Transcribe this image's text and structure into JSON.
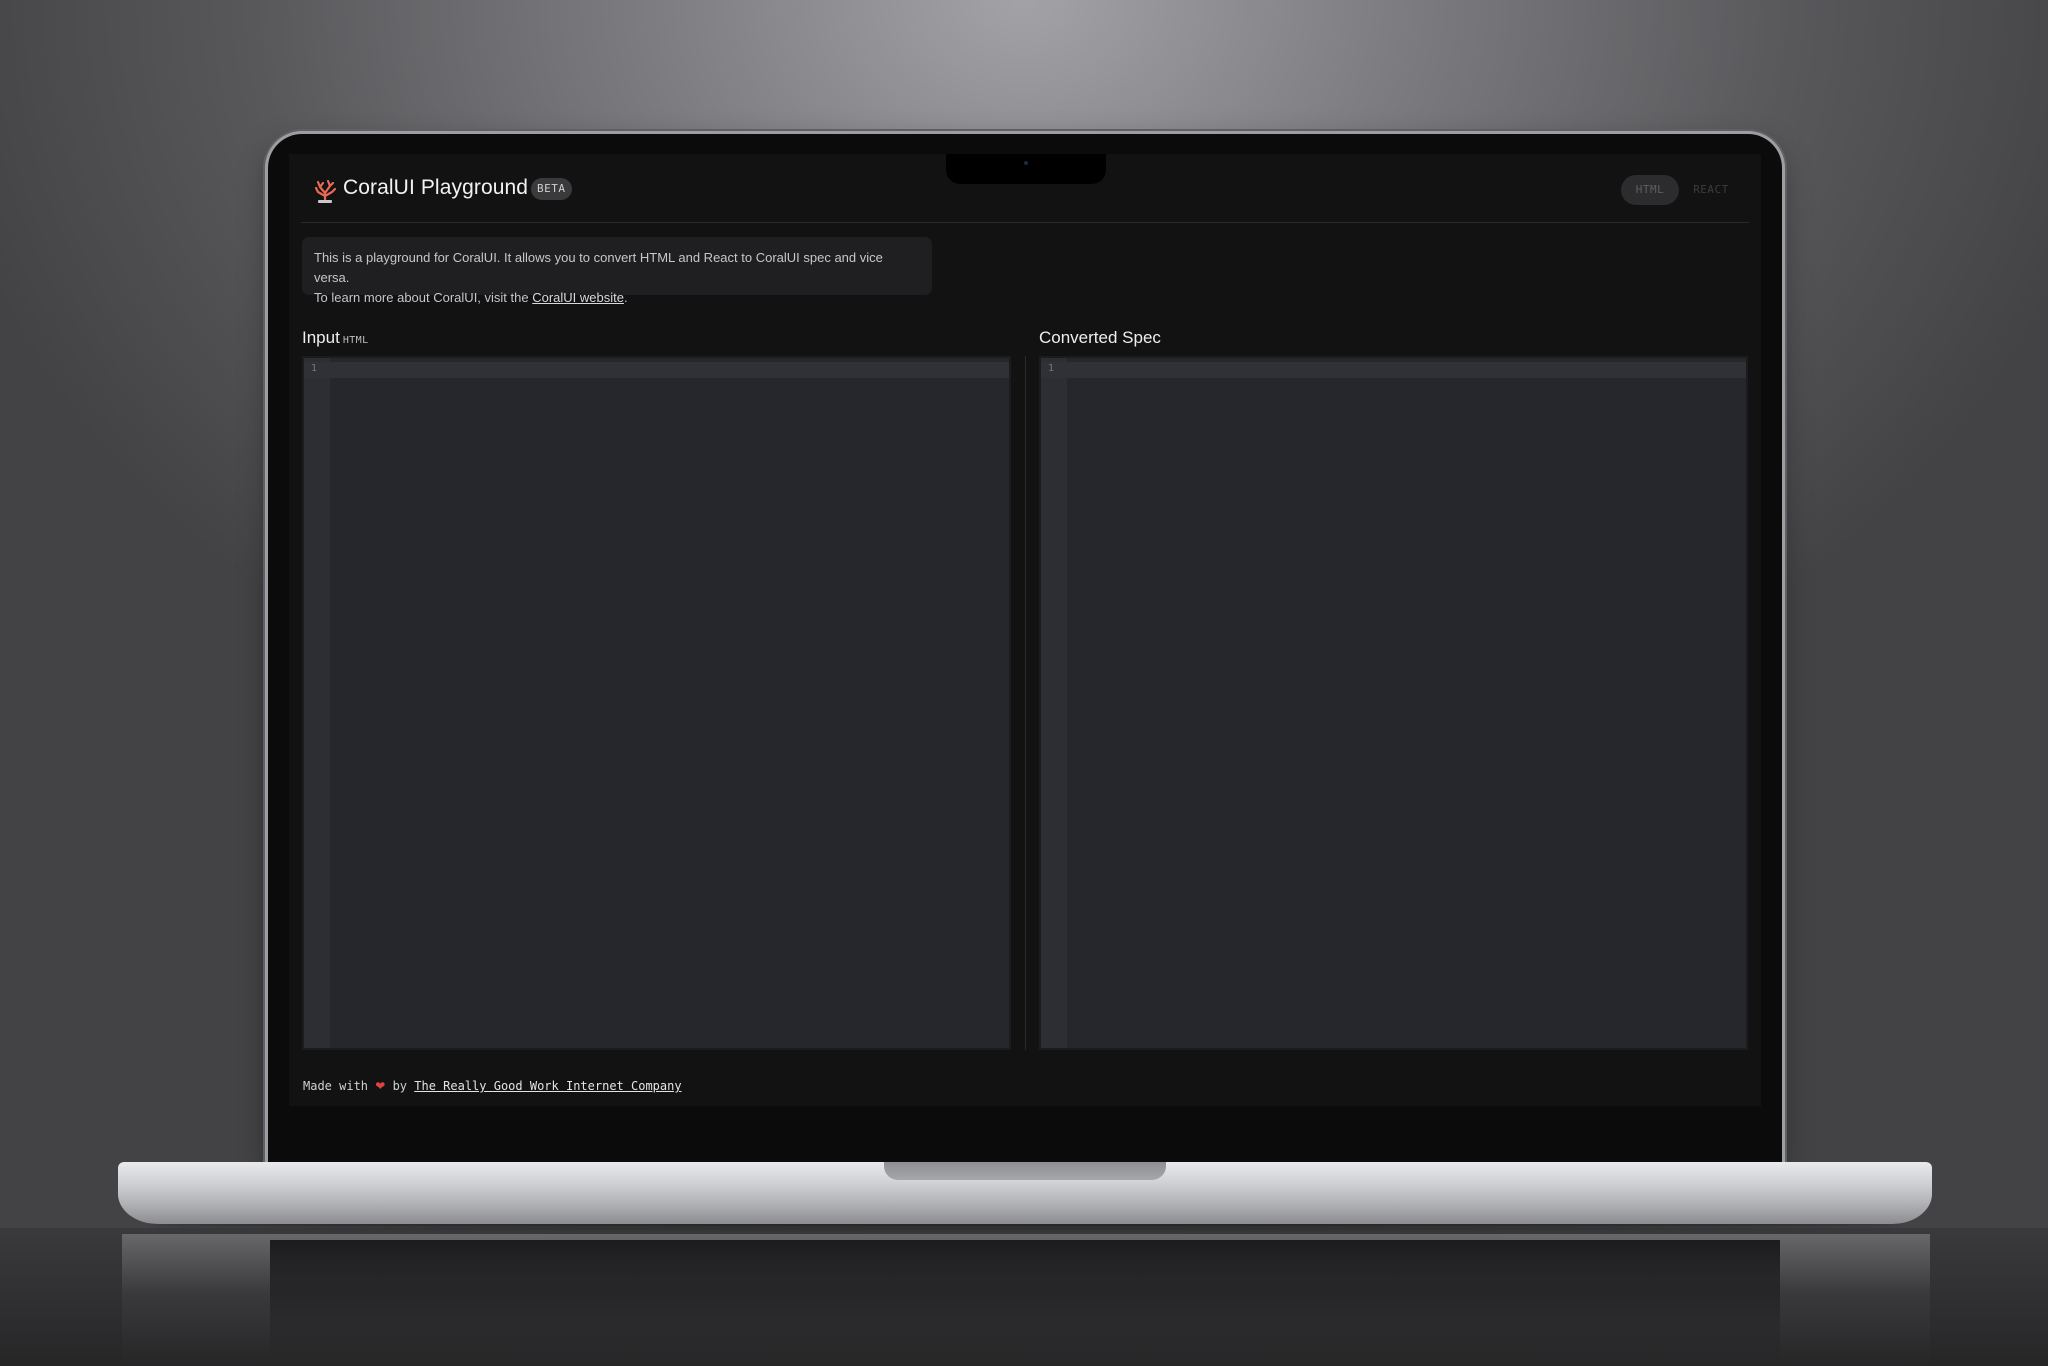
{
  "app": {
    "title": "CoralUI Playground",
    "badge": "BETA",
    "accent_color": "#e0443e"
  },
  "mode_toggle": {
    "options": [
      "HTML",
      "REACT"
    ],
    "selected": "HTML"
  },
  "info": {
    "text_line1": "This is a playground for CoralUI. It allows you to convert HTML and React to CoralUI spec and vice versa.",
    "text_line2_prefix": "To learn more about CoralUI, visit the ",
    "link_text": "CoralUI website",
    "text_line2_suffix": "."
  },
  "input_panel": {
    "label": "Input",
    "tag": "HTML",
    "line_number": "1",
    "content": ""
  },
  "output_panel": {
    "label": "Converted Spec",
    "line_number": "1",
    "content": ""
  },
  "footer": {
    "prefix": "Made with",
    "heart": "❤",
    "by": "by",
    "link_text": "The Really Good Work Internet Company"
  }
}
